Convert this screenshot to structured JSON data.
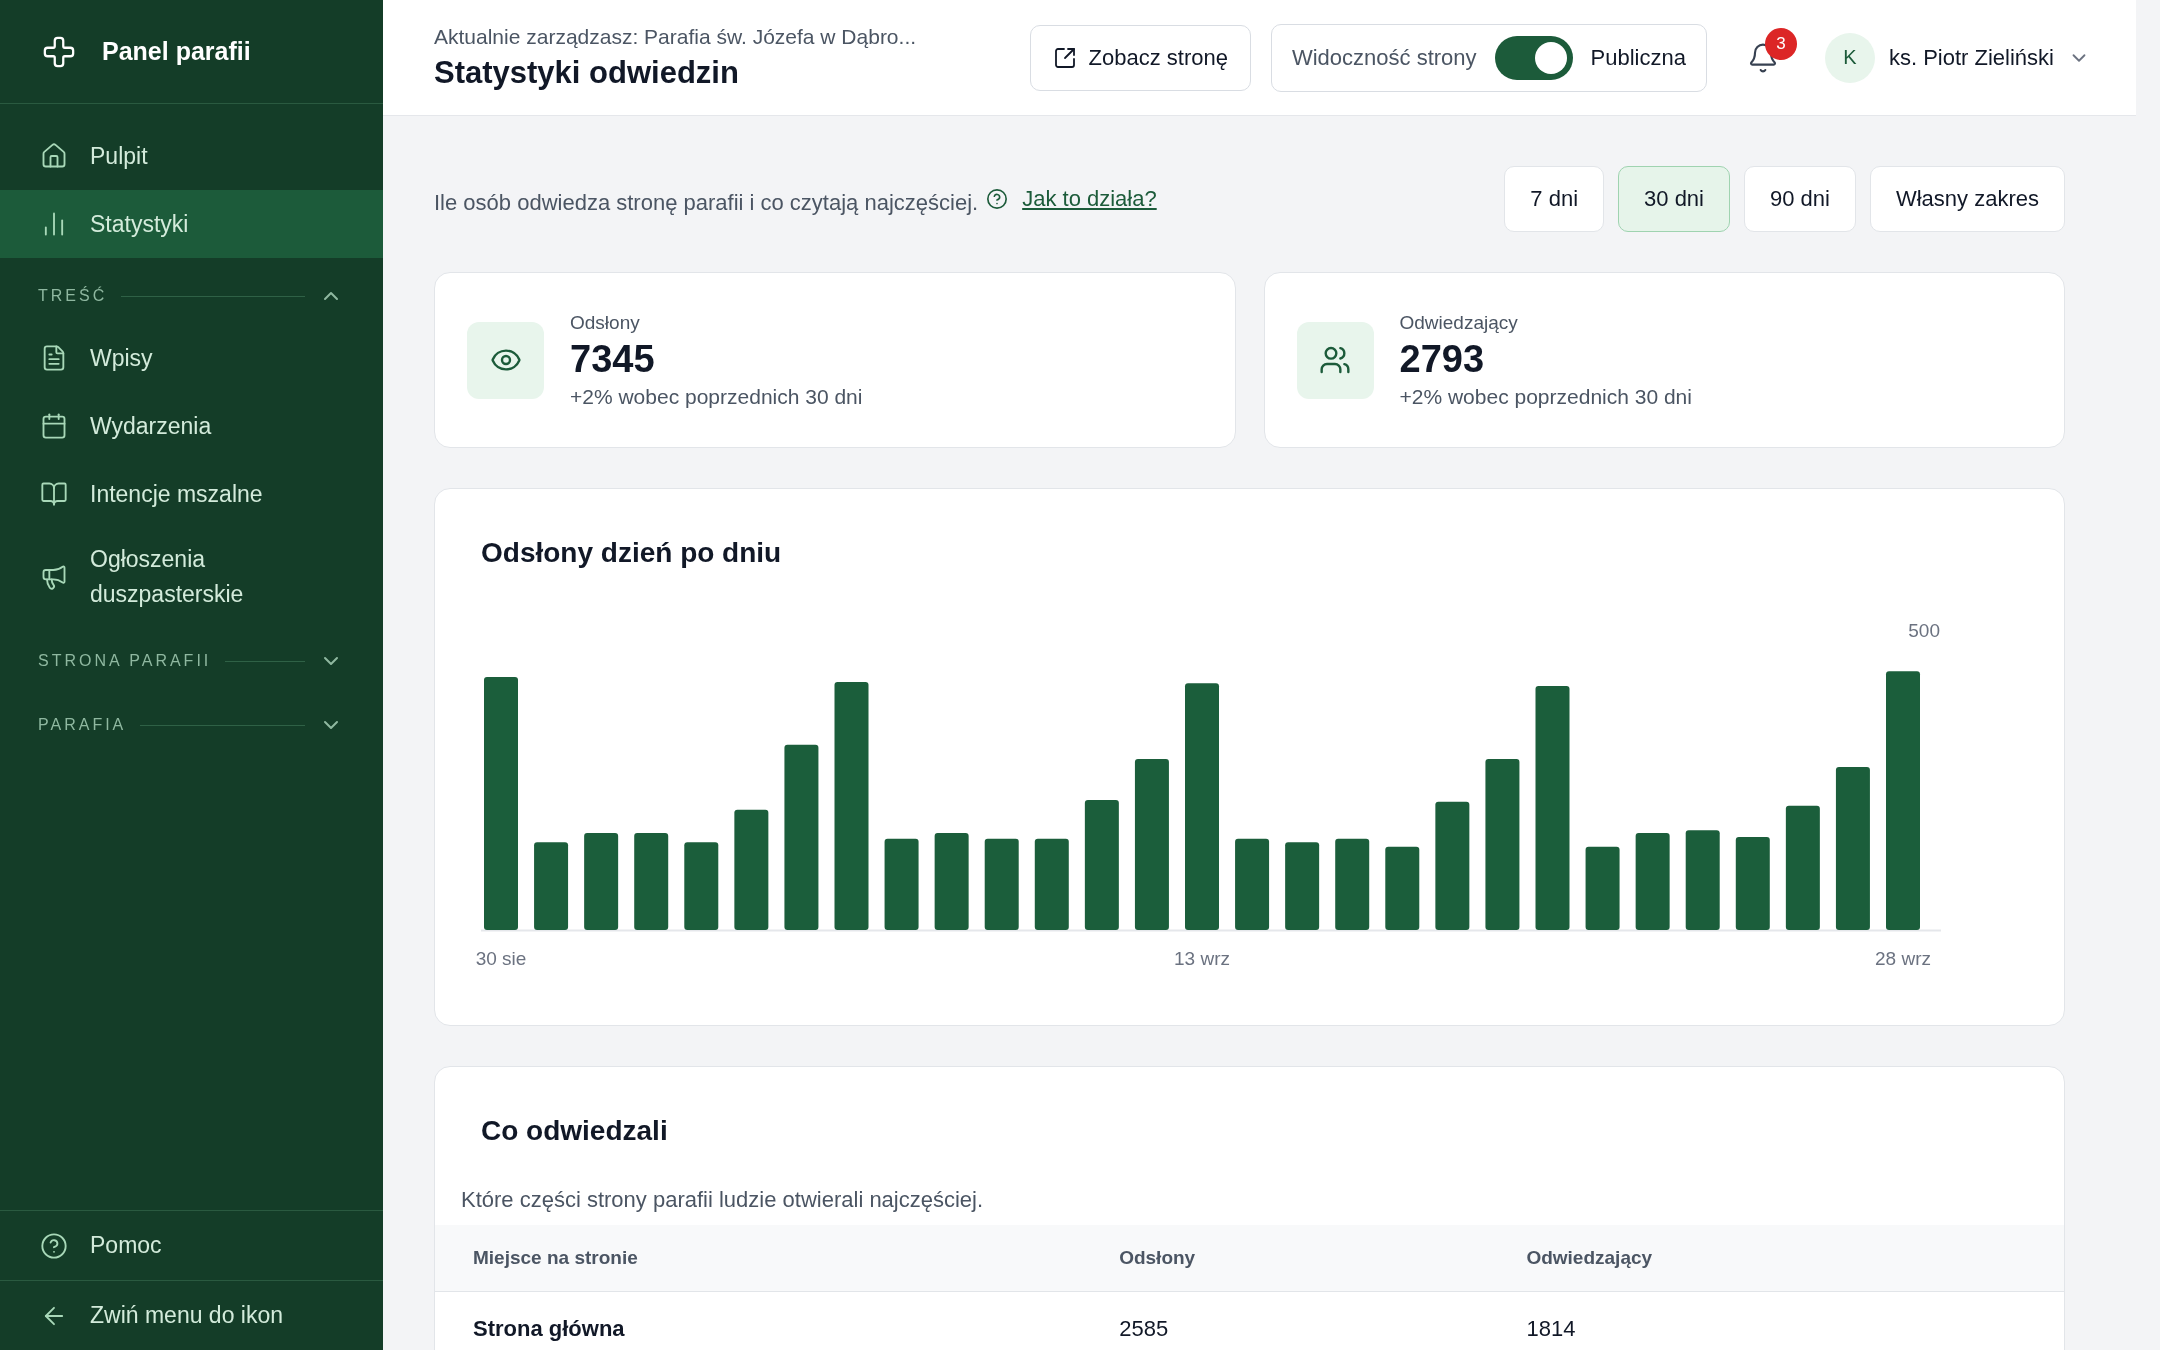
{
  "sidebar": {
    "title": "Panel parafii",
    "items": [
      {
        "label": "Pulpit",
        "selected": false
      },
      {
        "label": "Statystyki",
        "selected": true
      }
    ],
    "sections": [
      {
        "label": "TREŚĆ",
        "expanded": true,
        "items": [
          {
            "label": "Wpisy",
            "selected": false
          },
          {
            "label": "Wydarzenia",
            "selected": false
          },
          {
            "label": "Intencje mszalne",
            "selected": false
          },
          {
            "label": "Ogłoszenia duszpasterskie",
            "selected": false
          }
        ]
      },
      {
        "label": "STRONA PARAFII",
        "expanded": false
      },
      {
        "label": "PARAFIA",
        "expanded": false
      }
    ],
    "footer": [
      {
        "label": "Pomoc"
      },
      {
        "label": "Zwiń menu do ikon"
      }
    ]
  },
  "header": {
    "context": "Aktualnie zarządzasz: Parafia św. Józefa w Dąbro...",
    "title": "Statystyki odwiedzin",
    "view_button": "Zobacz stronę",
    "visibility": {
      "label": "Widoczność strony",
      "on": true,
      "value": "Publiczna"
    },
    "notifications": "3",
    "user": {
      "initial": "K",
      "name": "ks. Piotr Zieliński"
    }
  },
  "intro": {
    "text": "Ile osób odwiedza stronę parafii i co czytają najczęściej.",
    "link": "Jak to działa?"
  },
  "ranges": [
    {
      "label": "7 dni",
      "selected": false
    },
    {
      "label": "30 dni",
      "selected": true
    },
    {
      "label": "90 dni",
      "selected": false
    },
    {
      "label": "Własny zakres",
      "selected": false
    }
  ],
  "stats": [
    {
      "label": "Odsłony",
      "value": "7345",
      "change": "+2% wobec poprzednich 30 dni"
    },
    {
      "label": "Odwiedzający",
      "value": "2793",
      "change": "+2% wobec poprzednich 30 dni"
    }
  ],
  "chart": {
    "title": "Odsłony dzień po dniu",
    "y_label": "500",
    "x_labels": [
      "30 sie",
      "13 wrz",
      "28 wrz"
    ]
  },
  "table": {
    "title": "Co odwiedzali",
    "subtitle": "Które części strony parafii ludzie otwierali najczęściej.",
    "columns": [
      "Miejsce na stronie",
      "Odsłony",
      "Odwiedzający"
    ],
    "rows": [
      [
        "Strona główna",
        "2585",
        "1814"
      ]
    ]
  }
}
